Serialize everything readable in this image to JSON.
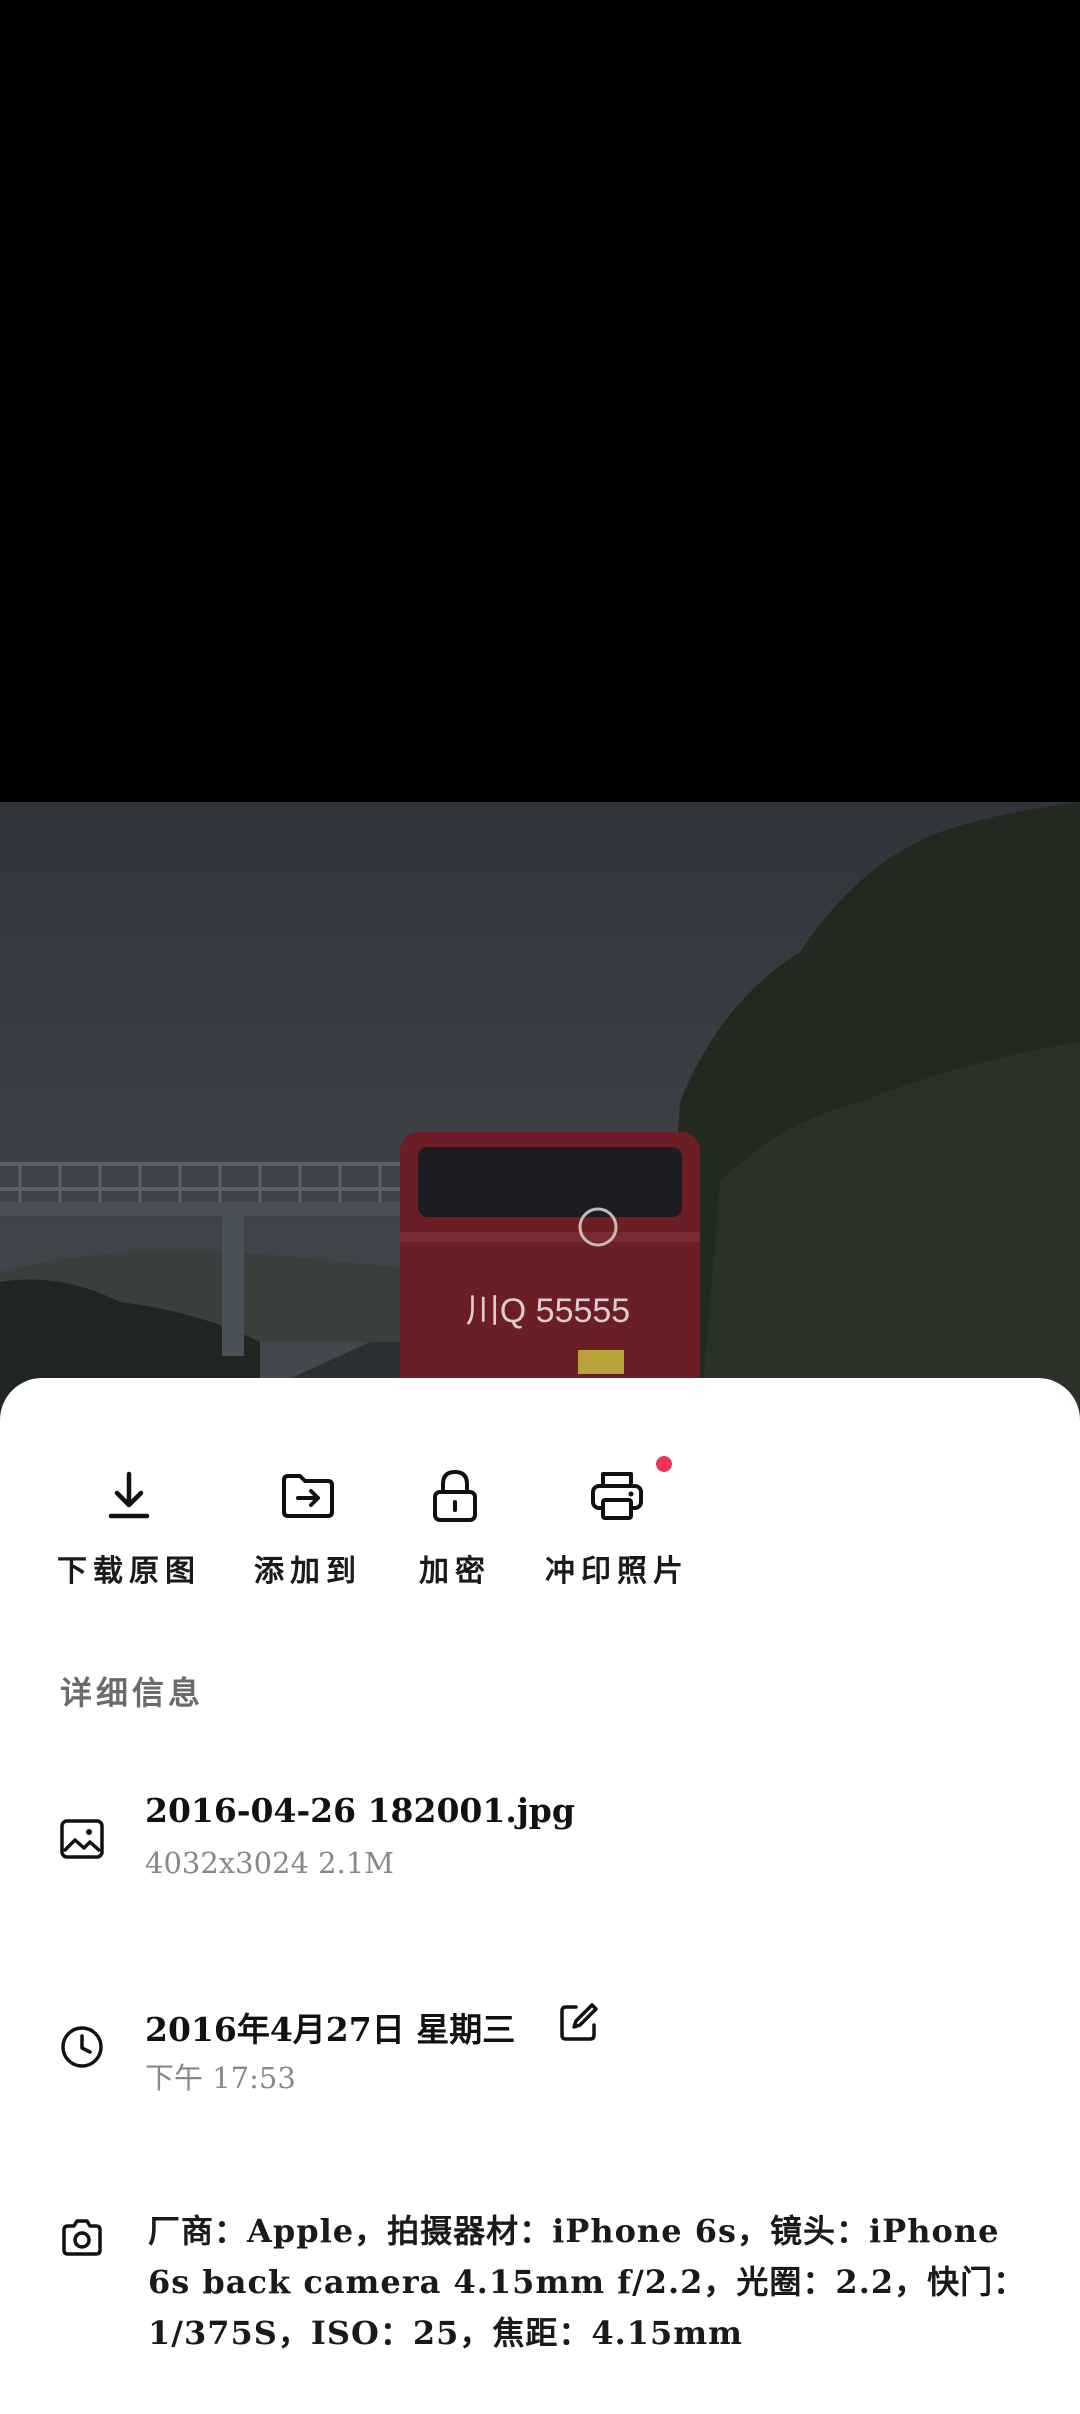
{
  "actions": [
    {
      "label": "下载原图",
      "icon": "download-icon"
    },
    {
      "label": "添加到",
      "icon": "folder-move-icon"
    },
    {
      "label": "加密",
      "icon": "lock-icon"
    },
    {
      "label": "冲印照片",
      "icon": "printer-icon",
      "badge": true
    }
  ],
  "details": {
    "title": "详细信息",
    "file": {
      "name": "2016-04-26 182001.jpg",
      "info": "4032x3024  2.1M",
      "icon": "image-icon"
    },
    "date": {
      "date": "2016年4月27日 星期三",
      "time": "下午 17:53",
      "icon": "clock-icon",
      "edit_icon": "edit-icon"
    },
    "camera": {
      "icon": "camera-icon",
      "text": "厂商：Apple，拍摄器材：iPhone 6s，镜头：iPhone 6s back camera 4.15mm f/2.2，光圈：2.2，快门：1/375S，ISO：25，焦距：4.15mm"
    }
  },
  "photo": {
    "plate": "川Q 55555"
  },
  "colors": {
    "accent_dot": "#e8365a"
  }
}
